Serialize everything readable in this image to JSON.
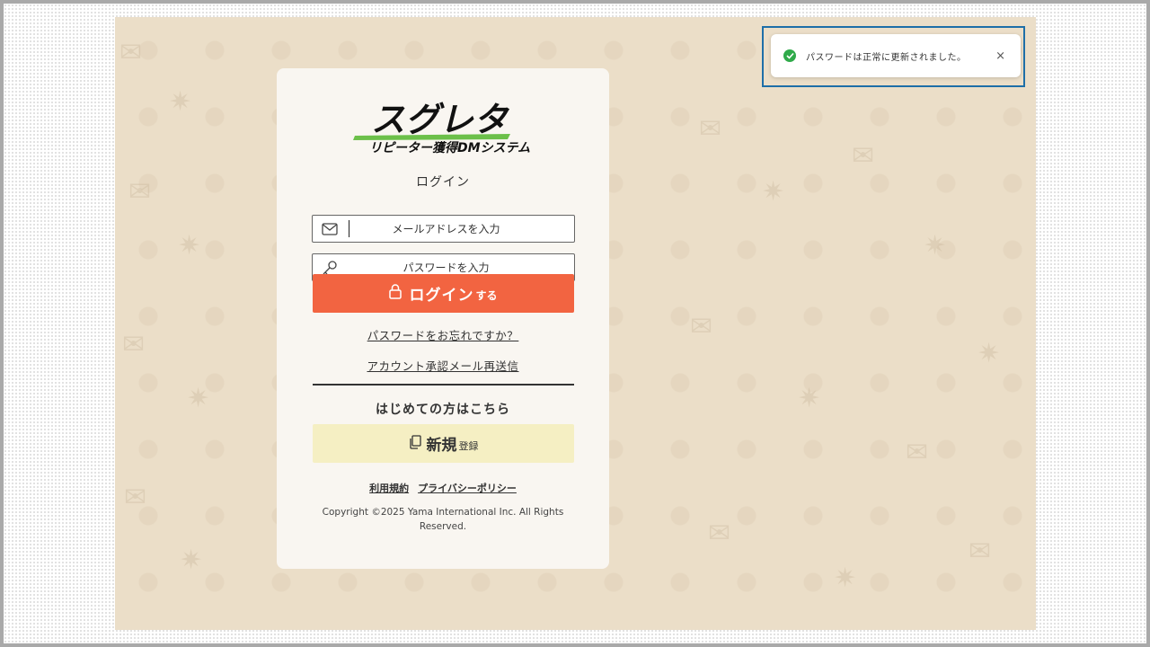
{
  "logo": {
    "brand": "スグレタ",
    "tagline": "リピーター獲得DMシステム"
  },
  "login": {
    "title": "ログイン",
    "email_placeholder": "メールアドレスを入力",
    "password_placeholder": "パスワードを入力",
    "submit_label": "ログイン",
    "submit_suffix": "する",
    "forgot_password": "パスワードをお忘れですか？",
    "resend_confirmation": "アカウント承認メール再送信"
  },
  "register": {
    "heading": "はじめての方はこちら",
    "button_label": "新規",
    "button_suffix": "登録"
  },
  "footer": {
    "terms": "利用規約",
    "privacy": "プライバシーポリシー",
    "copyright": "Copyright ©2025 Yama International Inc. All Rights Reserved."
  },
  "toast": {
    "message": "パスワードは正常に更新されました。",
    "close_symbol": "×"
  },
  "colors": {
    "login_button": "#f26441",
    "register_button": "#f5efc3",
    "background": "#ebdec8",
    "toast_success": "#2faa4a",
    "highlight_outline": "#1e6fa8"
  },
  "icons": {
    "email": "envelope-icon",
    "password": "key-icon",
    "login": "lock-icon",
    "register": "copy-icon",
    "toast_status": "check-circle-icon",
    "toast_close": "close-icon"
  }
}
